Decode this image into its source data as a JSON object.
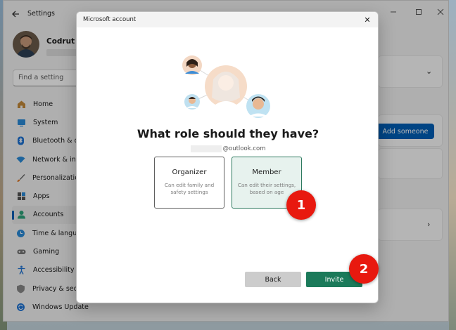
{
  "settings": {
    "app_title": "Settings",
    "profile_name": "Codrut Ne",
    "search_placeholder": "Find a setting",
    "add_someone_label": "Add someone",
    "nav": [
      {
        "label": "Home",
        "icon": "home-icon"
      },
      {
        "label": "System",
        "icon": "system-icon"
      },
      {
        "label": "Bluetooth & de",
        "icon": "bluetooth-icon"
      },
      {
        "label": "Network & inte",
        "icon": "network-icon"
      },
      {
        "label": "Personalization",
        "icon": "brush-icon"
      },
      {
        "label": "Apps",
        "icon": "apps-icon"
      },
      {
        "label": "Accounts",
        "icon": "accounts-icon",
        "selected": true
      },
      {
        "label": "Time & languag",
        "icon": "time-language-icon"
      },
      {
        "label": "Gaming",
        "icon": "gaming-icon"
      },
      {
        "label": "Accessibility",
        "icon": "accessibility-icon"
      },
      {
        "label": "Privacy & secur",
        "icon": "shield-icon"
      },
      {
        "label": "Windows Update",
        "icon": "windows-update-icon"
      }
    ]
  },
  "dialog": {
    "title": "Microsoft account",
    "heading": "What role should they have?",
    "email_domain": "@outlook.com",
    "roles": [
      {
        "title": "Organizer",
        "description": "Can edit family and safety settings"
      },
      {
        "title": "Member",
        "description": "Can edit their settings, based on age",
        "selected": true
      }
    ],
    "back_label": "Back",
    "invite_label": "Invite"
  },
  "markers": [
    "1",
    "2"
  ],
  "colors": {
    "accent_blue": "#005fb8",
    "invite_green": "#1b7a5a",
    "member_border": "#2d7a5f",
    "marker_red": "#e8190f"
  }
}
